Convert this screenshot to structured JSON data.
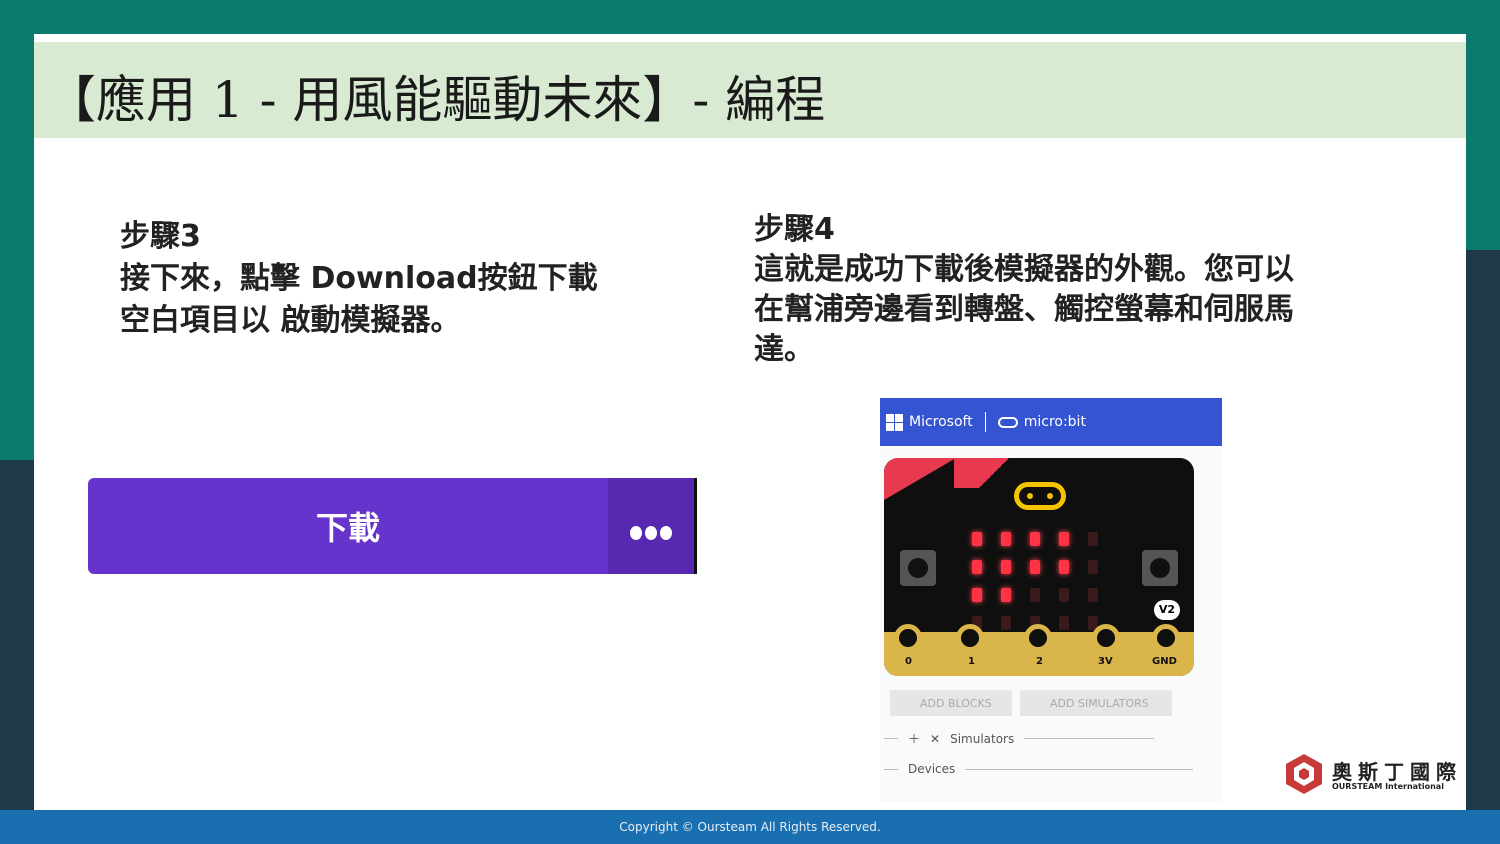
{
  "slide": {
    "title": "【應用 1 - 用風能驅動未來】- 編程"
  },
  "step3": {
    "heading": "步驟3",
    "line1": "接下來，點擊 Download按鈕下載",
    "line2": "空白項目以 啟動模擬器。"
  },
  "download_button": {
    "label": "下載",
    "more_icon": "ellipsis-icon"
  },
  "step4": {
    "heading": "步驟4",
    "line1": "這就是成功下載後模擬器的外觀。您可以",
    "line2": "在幫浦旁邊看到轉盤、觸控螢幕和伺服馬",
    "line3": "達。"
  },
  "simulator": {
    "brand": "Microsoft",
    "product": "micro:bit",
    "badge": "V2",
    "pins": [
      "0",
      "1",
      "2",
      "3V",
      "GND"
    ],
    "add_blocks": "ADD BLOCKS",
    "add_simulators": "ADD SIMULATORS",
    "simulators_label": "Simulators",
    "devices_label": "Devices"
  },
  "brand": {
    "name": "奧斯丁國際",
    "sub": "OURSTEAM International"
  },
  "footer": {
    "copyright": "Copyright © Oursteam All Rights Reserved."
  },
  "colors": {
    "teal": "#0b7a6c",
    "title_bg": "#d9ead3",
    "button_purple": "#6633cc",
    "footer_blue": "#1a6fb0",
    "microbit_header": "#3454d1"
  }
}
